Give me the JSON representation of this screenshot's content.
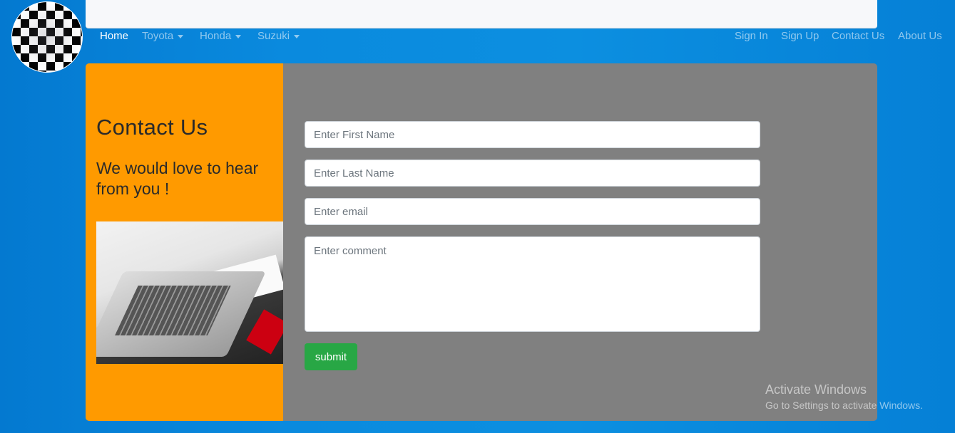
{
  "nav": {
    "left": [
      {
        "label": "Home",
        "active": true
      },
      {
        "label": "Toyota",
        "dropdown": true
      },
      {
        "label": "Honda",
        "dropdown": true
      },
      {
        "label": "Suzuki",
        "dropdown": true
      }
    ],
    "right": [
      "Sign In",
      "Sign Up",
      "Contact Us",
      "About Us"
    ]
  },
  "contact": {
    "title": "Contact Us",
    "subtitle": "We would love to hear from you !"
  },
  "form": {
    "first_name_placeholder": "Enter First Name",
    "last_name_placeholder": "Enter Last Name",
    "email_placeholder": "Enter email",
    "comment_placeholder": "Enter comment",
    "submit_label": "submit"
  },
  "watermark": {
    "line1": "Activate Windows",
    "line2": "Go to Settings to activate Windows."
  }
}
